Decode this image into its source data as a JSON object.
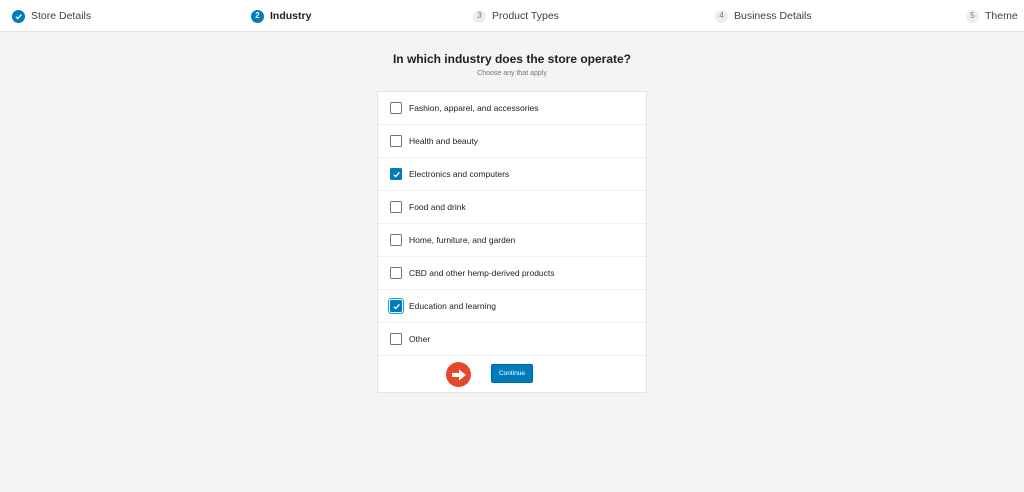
{
  "stepper": {
    "steps": [
      {
        "number": "1",
        "label": "Store Details",
        "status": "done"
      },
      {
        "number": "2",
        "label": "Industry",
        "status": "current"
      },
      {
        "number": "3",
        "label": "Product Types",
        "status": "todo"
      },
      {
        "number": "4",
        "label": "Business Details",
        "status": "todo"
      },
      {
        "number": "5",
        "label": "Theme",
        "status": "todo"
      }
    ]
  },
  "main": {
    "title": "In which industry does the store operate?",
    "subtitle": "Choose any that apply"
  },
  "options": [
    {
      "label": "Fashion, apparel, and accessories",
      "checked": false
    },
    {
      "label": "Health and beauty",
      "checked": false
    },
    {
      "label": "Electronics and computers",
      "checked": true
    },
    {
      "label": "Food and drink",
      "checked": false
    },
    {
      "label": "Home, furniture, and garden",
      "checked": false
    },
    {
      "label": "CBD and other hemp-derived products",
      "checked": false
    },
    {
      "label": "Education and learning",
      "checked": true
    },
    {
      "label": "Other",
      "checked": false
    }
  ],
  "footer": {
    "continue_label": "Continue",
    "arrow_icon": "arrow-right-icon"
  },
  "colors": {
    "accent": "#007cba",
    "annotation": "#e5472c"
  }
}
